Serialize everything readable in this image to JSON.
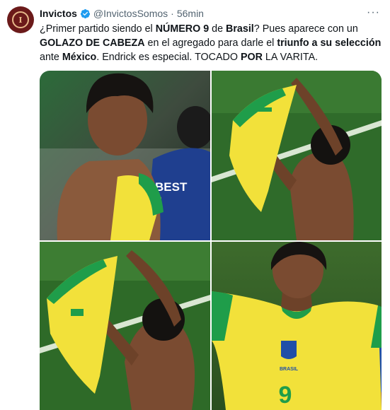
{
  "tweet": {
    "author_name": "Invictos",
    "handle": "@InvictosSomos",
    "separator": "·",
    "time": "56min",
    "avatar_letter": "I",
    "more_label": "···",
    "text_parts": [
      {
        "t": "¿Primer partido siendo el ",
        "b": false
      },
      {
        "t": "NÚMERO 9",
        "b": true
      },
      {
        "t": " de ",
        "b": false
      },
      {
        "t": "Brasil",
        "b": true
      },
      {
        "t": "? Pues aparece con un ",
        "b": false
      },
      {
        "t": "GOLAZO DE CABEZA",
        "b": true
      },
      {
        "t": " en el agregado para darle el ",
        "b": false
      },
      {
        "t": "triunfo a su selección",
        "b": true
      },
      {
        "t": " ante ",
        "b": false
      },
      {
        "t": "México",
        "b": true
      },
      {
        "t": ". Endrick es especial. TOCADO ",
        "b": false
      },
      {
        "t": "POR",
        "b": true
      },
      {
        "t": " LA VARITA.",
        "b": false
      }
    ]
  },
  "photos": {
    "photo1_shirt_text": "BEST",
    "photo4_crest_text": "BRASIL",
    "photo4_number": "9"
  },
  "colors": {
    "text": "#0f1419",
    "secondary": "#536471",
    "verified": "#1d9bf0",
    "brazil_yellow": "#f2e13a",
    "brazil_green": "#1f9d4a",
    "pitch": "#2f6b2a"
  }
}
